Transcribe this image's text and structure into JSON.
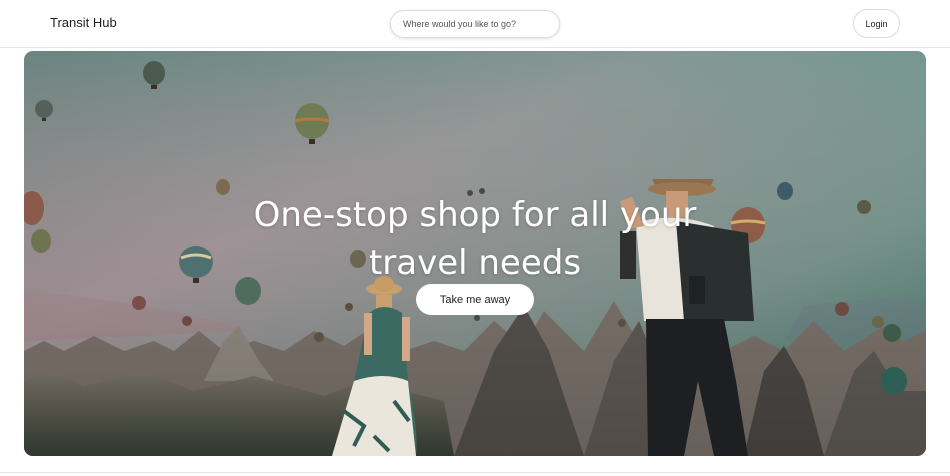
{
  "header": {
    "brand": "Transit Hub",
    "search_placeholder": "Where would you like to go?",
    "login_label": "Login"
  },
  "hero": {
    "headline_line1": "One-stop shop for all your",
    "headline_line2": "travel needs",
    "cta_label": "Take me away",
    "image_subject": "travel-photo-balloons-couple"
  },
  "colors": {
    "sky_top": "#3c8574",
    "sky_mid": "#a9a0a5",
    "horizon": "#c7a7ab",
    "rocks": "#7a6f68",
    "cta_bg": "#ffffff",
    "text_light": "#ffffff"
  }
}
